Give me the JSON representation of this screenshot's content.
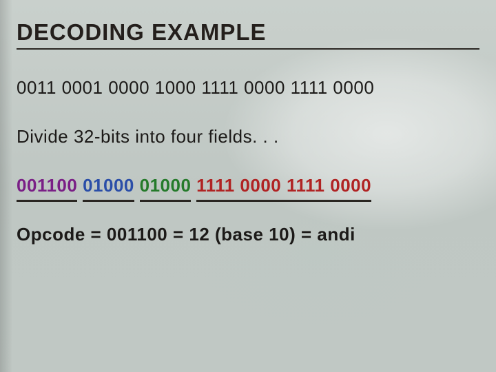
{
  "title": "DECODING EXAMPLE",
  "raw_bits": "0011 0001 0000 1000 1111 0000 1111 0000",
  "instr": "Divide 32-bits into four fields. . .",
  "fields": {
    "f0": "001100",
    "f1": "01000",
    "f2": "01000",
    "f3": "1111 0000 1111 0000"
  },
  "result": "Opcode = 001100 = 12 (base 10) = andi"
}
